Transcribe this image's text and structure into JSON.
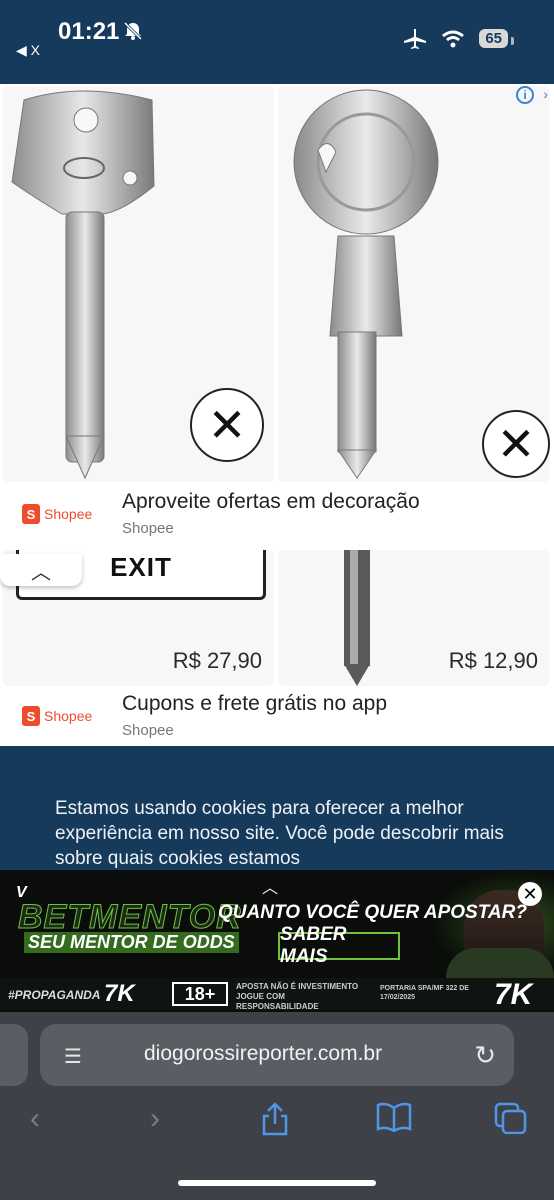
{
  "status_bar": {
    "time": "01:21",
    "back_label": "◀ X",
    "battery": "65"
  },
  "ads": {
    "cards": [
      {
        "image": "key-icon",
        "close_symbol": "✕"
      },
      {
        "image": "key-icon",
        "close_symbol": "✕"
      },
      {
        "sign_text": "EXIT",
        "price": "R$ 27,90"
      },
      {
        "price": "R$ 12,90"
      }
    ],
    "rows": [
      {
        "brand": "Shopee",
        "title": "Aproveite ofertas em decoração",
        "subtitle": "Shopee"
      },
      {
        "brand": "Shopee",
        "title": "Cupons e frete grátis no app",
        "subtitle": "Shopee"
      }
    ]
  },
  "cookie_notice": {
    "text": "Estamos usando cookies para oferecer a melhor experiência em nosso site. Você pode descobrir mais sobre quais cookies estamos"
  },
  "banner": {
    "brand_v": "V",
    "brand": "BETMENTOR",
    "tagline": "SEU MENTOR DE ODDS",
    "question": "QUANTO VOCÊ QUER APOSTAR?",
    "cta": "SABER MAIS",
    "hashtag": "#PROPAGANDA",
    "logo_text": "7K",
    "age": "18+",
    "warning": "APOSTA NÃO É INVESTIMENTO JOGUE COM RESPONSABILIDADE",
    "portaria": "PORTARIA SPA/MF 322 DE 17/02/2025"
  },
  "browser": {
    "url": "diogorossireporter.com.br"
  },
  "colors": {
    "page_bg": "#163a5c",
    "shopee": "#ee4d2d",
    "bet_green": "#6ec23b",
    "ios_blue": "#4f95e8"
  }
}
